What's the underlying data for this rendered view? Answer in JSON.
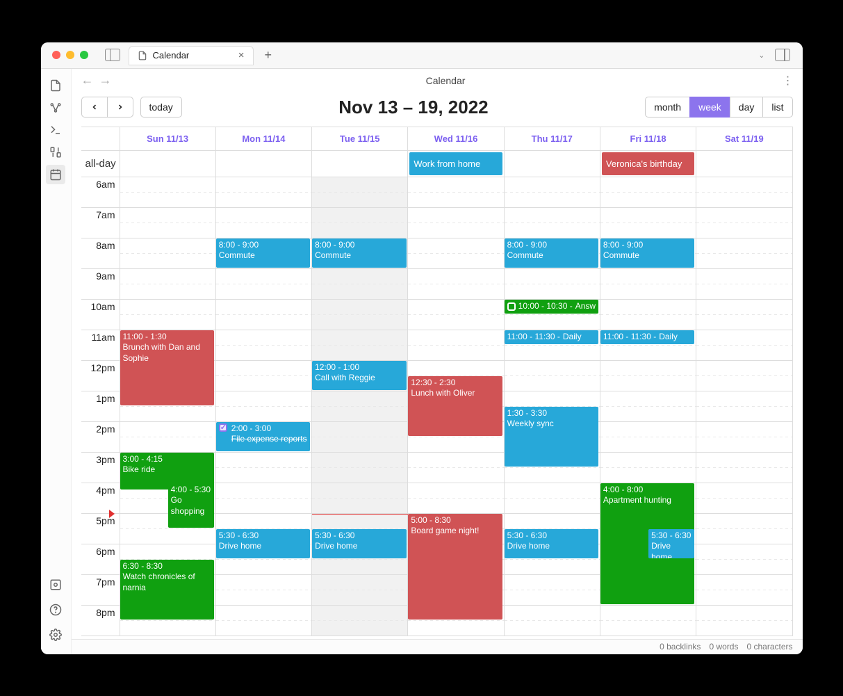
{
  "window": {
    "tab_title": "Calendar",
    "nav_title": "Calendar"
  },
  "toolbar": {
    "today_label": "today",
    "views": {
      "month": "month",
      "week": "week",
      "day": "day",
      "list": "list"
    },
    "active_view": "week",
    "title": "Nov 13 – 19, 2022"
  },
  "days": [
    {
      "label": "Sun 11/13"
    },
    {
      "label": "Mon 11/14"
    },
    {
      "label": "Tue 11/15",
      "today": true
    },
    {
      "label": "Wed 11/16"
    },
    {
      "label": "Thu 11/17"
    },
    {
      "label": "Fri 11/18"
    },
    {
      "label": "Sat 11/19"
    }
  ],
  "hour_labels": [
    "6am",
    "7am",
    "8am",
    "9am",
    "10am",
    "11am",
    "12pm",
    "1pm",
    "2pm",
    "3pm",
    "4pm",
    "5pm",
    "6pm",
    "7pm",
    "8pm"
  ],
  "allday_label": "all-day",
  "allday_events": [
    {
      "day": 3,
      "title": "Work from home",
      "color": "blue"
    },
    {
      "day": 5,
      "title": "Veronica's birthday",
      "color": "red"
    }
  ],
  "events": [
    {
      "day": 0,
      "start": 11.0,
      "end": 13.5,
      "time": "11:00 - 1:30",
      "title": "Brunch with Dan and Sophie",
      "color": "red"
    },
    {
      "day": 0,
      "start": 15.0,
      "end": 16.25,
      "time": "3:00 - 4:15",
      "title": "Bike ride",
      "color": "green"
    },
    {
      "day": 0,
      "start": 16.0,
      "end": 17.5,
      "time": "4:00 - 5:30",
      "title": "Go shopping",
      "color": "green",
      "left": 0.5,
      "width": 0.48
    },
    {
      "day": 0,
      "start": 18.5,
      "end": 20.5,
      "time": "6:30 - 8:30",
      "title": "Watch chronicles of narnia",
      "color": "green"
    },
    {
      "day": 1,
      "start": 8.0,
      "end": 9.0,
      "time": "8:00 - 9:00",
      "title": "Commute",
      "color": "blue"
    },
    {
      "day": 1,
      "start": 14.0,
      "end": 15.0,
      "time": "2:00 - 3:00",
      "title": "File expense reports",
      "color": "blue",
      "task": true,
      "done": true
    },
    {
      "day": 1,
      "start": 17.5,
      "end": 18.5,
      "time": "5:30 - 6:30",
      "title": "Drive home",
      "color": "blue"
    },
    {
      "day": 2,
      "start": 8.0,
      "end": 9.0,
      "time": "8:00 - 9:00",
      "title": "Commute",
      "color": "blue"
    },
    {
      "day": 2,
      "start": 12.0,
      "end": 13.0,
      "time": "12:00 - 1:00",
      "title": "Call with Reggie",
      "color": "blue"
    },
    {
      "day": 2,
      "start": 17.5,
      "end": 18.5,
      "time": "5:30 - 6:30",
      "title": "Drive home",
      "color": "blue"
    },
    {
      "day": 3,
      "start": 12.5,
      "end": 14.5,
      "time": "12:30 - 2:30",
      "title": "Lunch with Oliver",
      "color": "red"
    },
    {
      "day": 3,
      "start": 17.0,
      "end": 20.5,
      "time": "5:00 - 8:30",
      "title": "Board game night!",
      "color": "red"
    },
    {
      "day": 4,
      "start": 8.0,
      "end": 9.0,
      "time": "8:00 - 9:00",
      "title": "Commute",
      "color": "blue"
    },
    {
      "day": 4,
      "start": 10.0,
      "end": 10.5,
      "time": "10:00 - 10:30",
      "title": "Answer emails",
      "title_display": "Answ",
      "color": "green",
      "task": true,
      "done": false,
      "horiz": true
    },
    {
      "day": 4,
      "start": 11.0,
      "end": 11.5,
      "time": "11:00 - 11:30",
      "title": "Daily Standup",
      "title_display": "Daily",
      "color": "blue",
      "horiz": true
    },
    {
      "day": 4,
      "start": 13.5,
      "end": 15.5,
      "time": "1:30 - 3:30",
      "title": "Weekly sync",
      "color": "blue"
    },
    {
      "day": 4,
      "start": 17.5,
      "end": 18.5,
      "time": "5:30 - 6:30",
      "title": "Drive home",
      "color": "blue"
    },
    {
      "day": 5,
      "start": 8.0,
      "end": 9.0,
      "time": "8:00 - 9:00",
      "title": "Commute",
      "color": "blue"
    },
    {
      "day": 5,
      "start": 11.0,
      "end": 11.5,
      "time": "11:00 - 11:30",
      "title": "Daily Standup",
      "title_display": "Daily",
      "color": "blue",
      "horiz": true
    },
    {
      "day": 5,
      "start": 16.0,
      "end": 20.0,
      "time": "4:00 - 8:00",
      "title": "Apartment hunting",
      "color": "green"
    },
    {
      "day": 5,
      "start": 17.5,
      "end": 18.5,
      "time": "5:30 - 6:30",
      "title": "Drive home",
      "color": "blue",
      "left": 0.5,
      "width": 0.48
    }
  ],
  "now": {
    "day": 2,
    "hour": 17.0
  },
  "status": {
    "backlinks": "0 backlinks",
    "words": "0 words",
    "chars": "0 characters"
  },
  "colors": {
    "blue": "#27a8d9",
    "red": "#d05355",
    "green": "#10a010",
    "accent": "#8c74ed"
  }
}
